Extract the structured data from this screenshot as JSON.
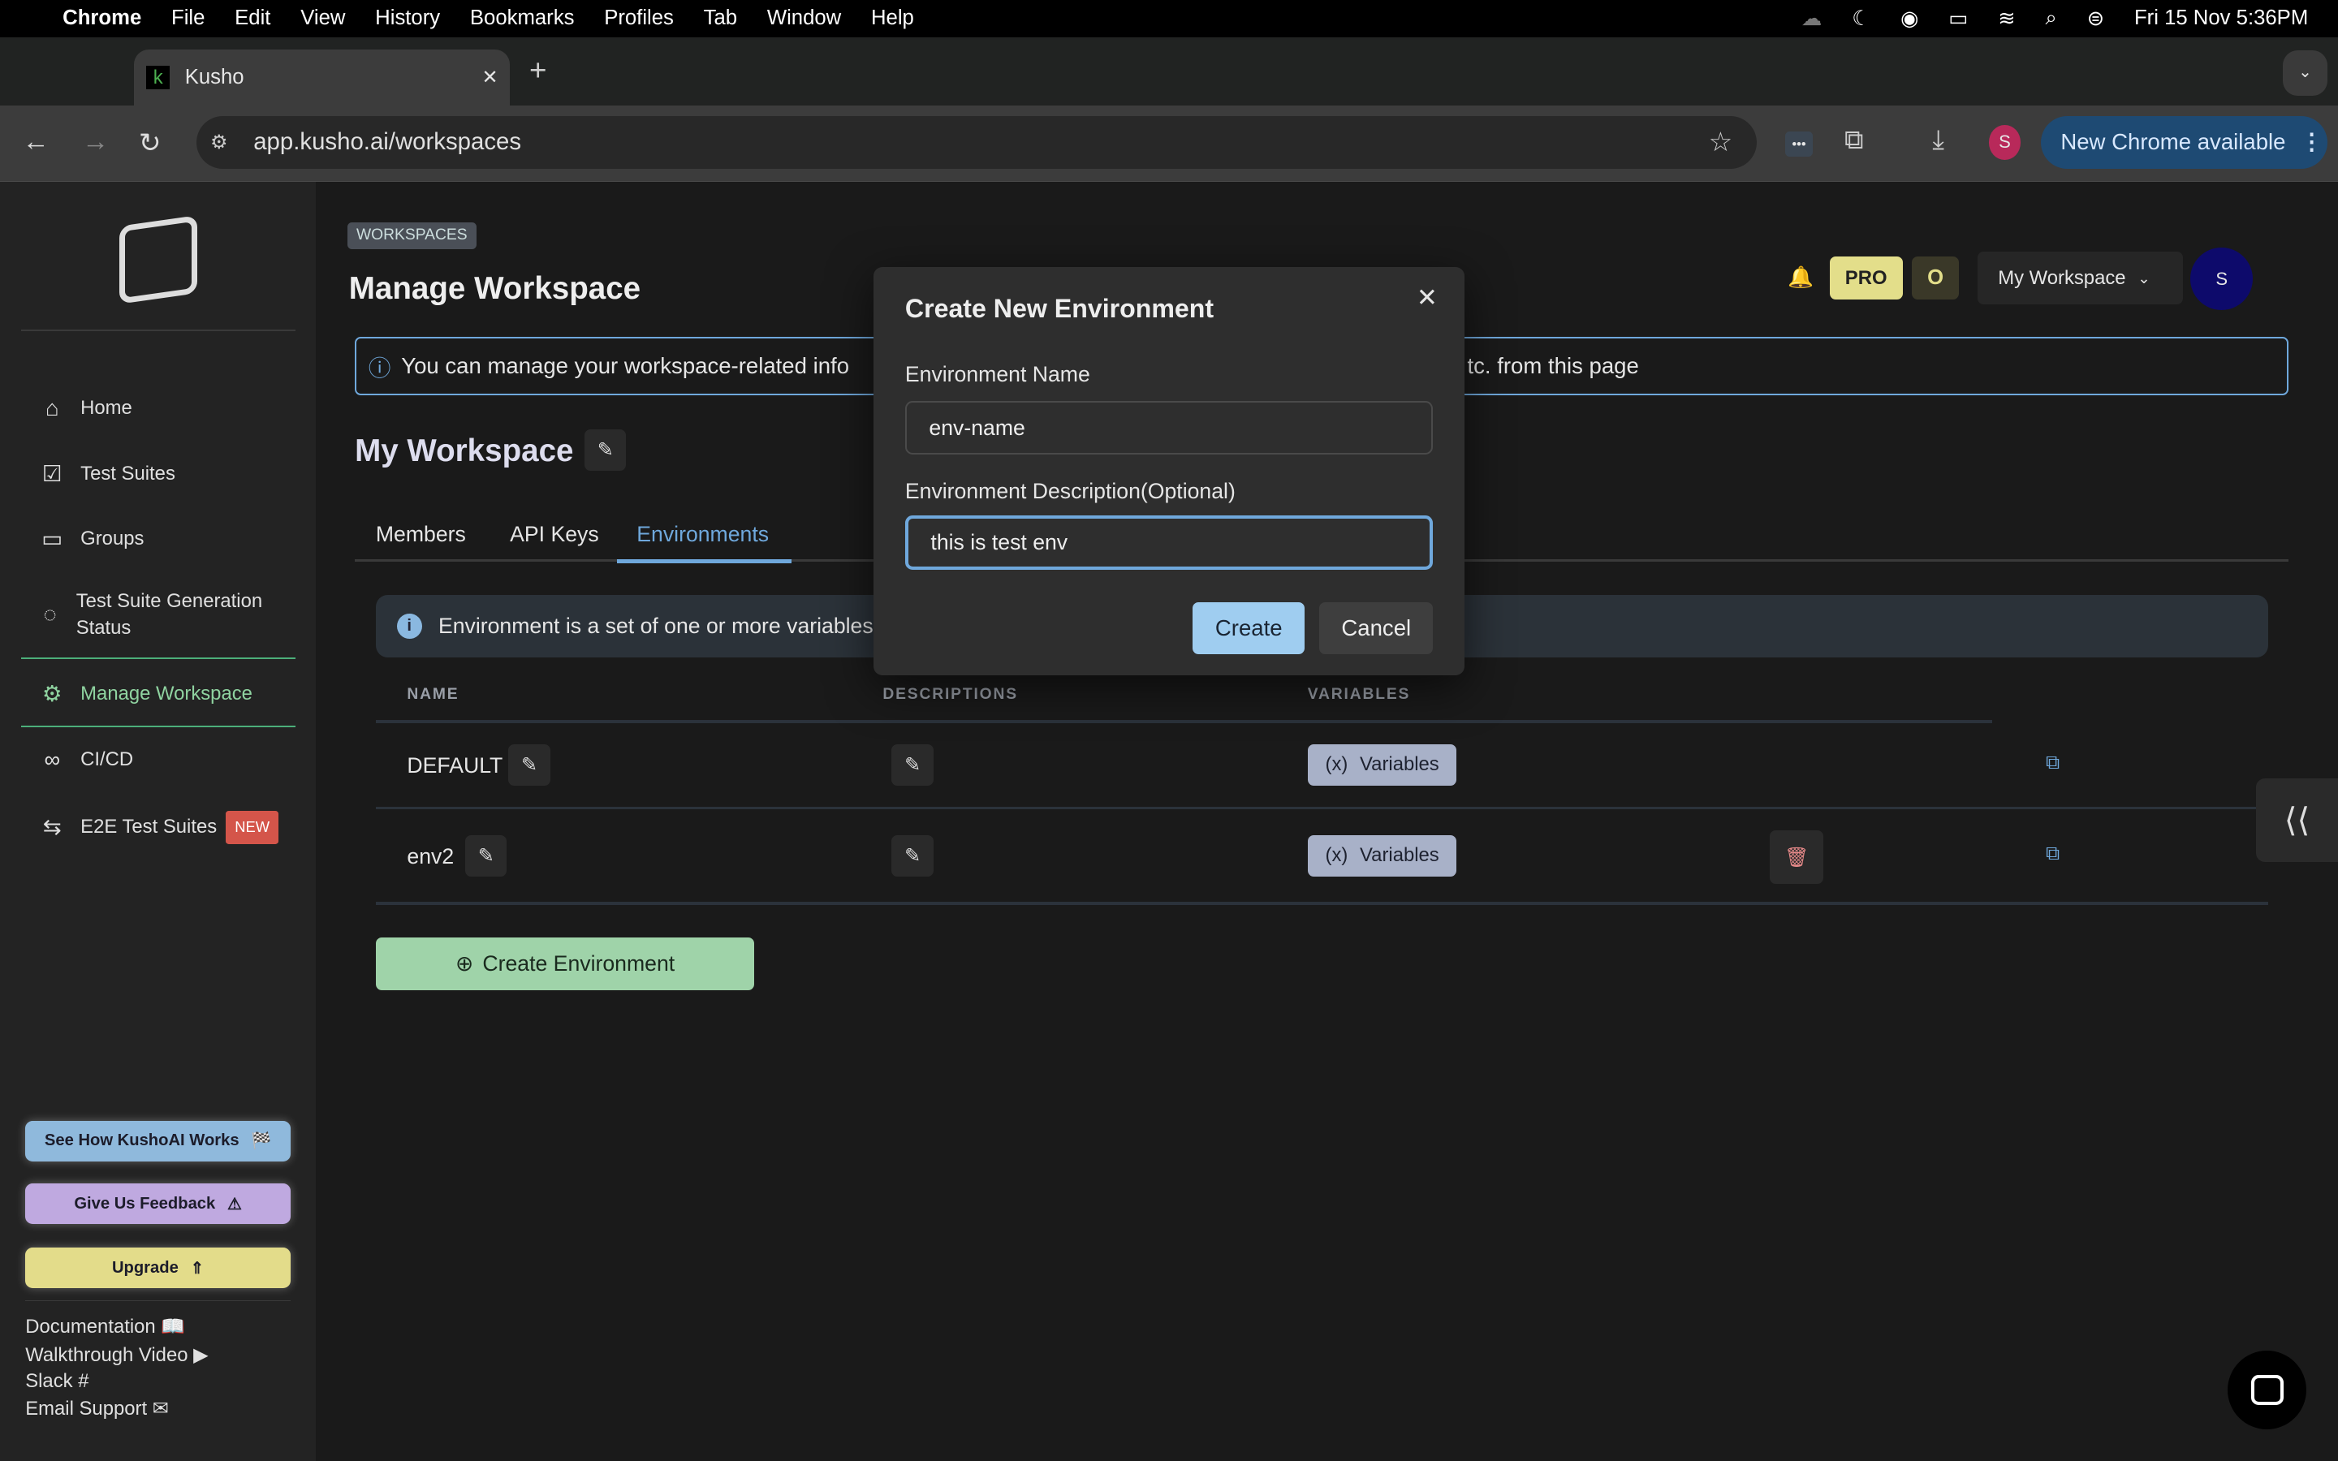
{
  "menubar": {
    "app": "Chrome",
    "items": [
      "File",
      "Edit",
      "View",
      "History",
      "Bookmarks",
      "Profiles",
      "Tab",
      "Window",
      "Help"
    ],
    "clock": "Fri 15 Nov  5:36PM"
  },
  "browser": {
    "tab_title": "Kusho",
    "favicon_letter": "k",
    "url": "app.kusho.ai/workspaces",
    "profile_initial": "S",
    "update_label": "New Chrome available"
  },
  "sidebar": {
    "items": [
      {
        "label": "Home",
        "icon": "home-icon"
      },
      {
        "label": "Test Suites",
        "icon": "checklist-icon"
      },
      {
        "label": "Groups",
        "icon": "folder-icon"
      },
      {
        "label": "Test Suite Generation Status",
        "icon": "status-icon"
      },
      {
        "label": "Manage Workspace",
        "icon": "gear-icon",
        "active": true
      },
      {
        "label": "CI/CD",
        "icon": "infinity-icon"
      },
      {
        "label": "E2E Test Suites",
        "icon": "arrows-icon",
        "badge": "NEW"
      }
    ],
    "buttons": {
      "how": "See How KushoAI Works",
      "feedback": "Give Us Feedback",
      "upgrade": "Upgrade"
    },
    "links": [
      "Documentation",
      "Walkthrough Video",
      "Slack",
      "Email Support"
    ]
  },
  "header": {
    "breadcrumb": "WORKSPACES",
    "title": "Manage Workspace",
    "plan": "PRO",
    "credits": "O",
    "workspace_select": "My Workspace",
    "avatar": "S"
  },
  "info_banner": {
    "left": "You can manage your workspace-related info",
    "right": "tc. from this page"
  },
  "workspace": {
    "name": "My Workspace",
    "tabs": [
      "Members",
      "API Keys",
      "Environments"
    ],
    "active_tab": "Environments"
  },
  "env_info": "Environment is a set of one or more variables",
  "table": {
    "headers": [
      "NAME",
      "DESCRIPTIONS",
      "VARIABLES"
    ],
    "rows": [
      {
        "name": "DEFAULT",
        "variables_label": "Variables",
        "deletable": false
      },
      {
        "name": "env2",
        "variables_label": "Variables",
        "deletable": true
      }
    ]
  },
  "create_env_label": "Create Environment",
  "modal": {
    "title": "Create New Environment",
    "name_label": "Environment Name",
    "name_value": "env-name",
    "desc_label": "Environment Description(Optional)",
    "desc_value": "this is test env",
    "create": "Create",
    "cancel": "Cancel"
  },
  "colors": {
    "accent": "#6fa8dc",
    "create_env": "#9fd3a9",
    "pro": "#e3de8a",
    "variables": "#a8b1c8",
    "delete": "#e88a8a"
  }
}
